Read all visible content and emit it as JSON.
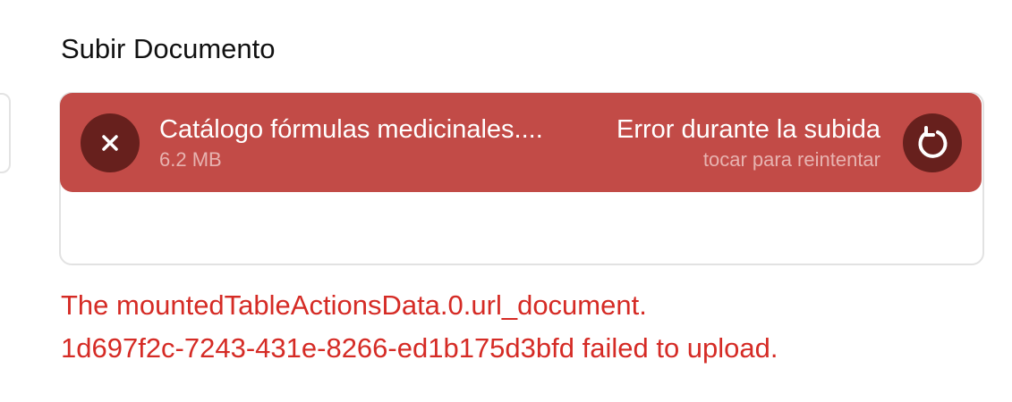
{
  "field": {
    "label": "Subir Documento"
  },
  "upload": {
    "file_name": "Catálogo fórmulas medicinales....",
    "file_size": "6.2 MB",
    "status": "Error durante la subida",
    "retry_hint": "tocar para reintentar",
    "remove_icon": "close-icon",
    "retry_icon": "retry-icon"
  },
  "error": {
    "line1": "The mountedTableActionsData.0.url_document.",
    "line2": "1d697f2c-7243-431e-8266-ed1b175d3bfd failed to upload."
  },
  "colors": {
    "error_background": "#c24b47",
    "button_background": "#67201d",
    "error_text": "#d52b25"
  }
}
